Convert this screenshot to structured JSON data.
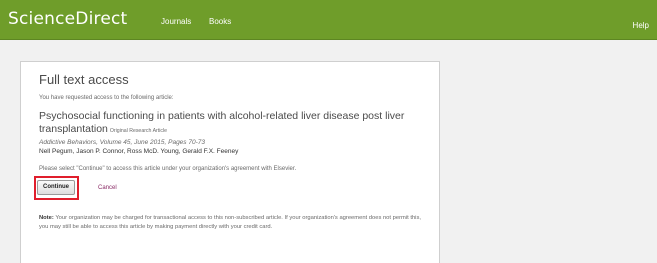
{
  "header": {
    "brand": "ScienceDirect",
    "nav": [
      "Journals",
      "Books"
    ],
    "help": "Help"
  },
  "panel": {
    "heading": "Full text access",
    "intro": "You have requested access to the following article:",
    "article": {
      "title": "Psychosocial functioning in patients with alcohol-related liver disease post liver transplantation",
      "type": "Original Research Article",
      "journal_ref": "Addictive Behaviors, Volume 45, June 2015, Pages 70-73",
      "authors": "Nell Pegum, Jason P. Connor, Ross McD. Young, Gerald F.X. Feeney"
    },
    "instruction": "Please select \"Continue\" to access this article under your organization's agreement with Elsevier.",
    "continue_label": "Continue",
    "cancel_label": "Cancel",
    "note_label": "Note:",
    "note_text": " Your organization may be charged for transactional access to this non-subscribed article. If your organization's agreement does not permit this, you may still be able to access this article by making payment directly with your credit card."
  },
  "colors": {
    "brand_green": "#6f9d2a",
    "highlight_red": "#e01e2c",
    "cancel_link": "#8a2a66"
  }
}
